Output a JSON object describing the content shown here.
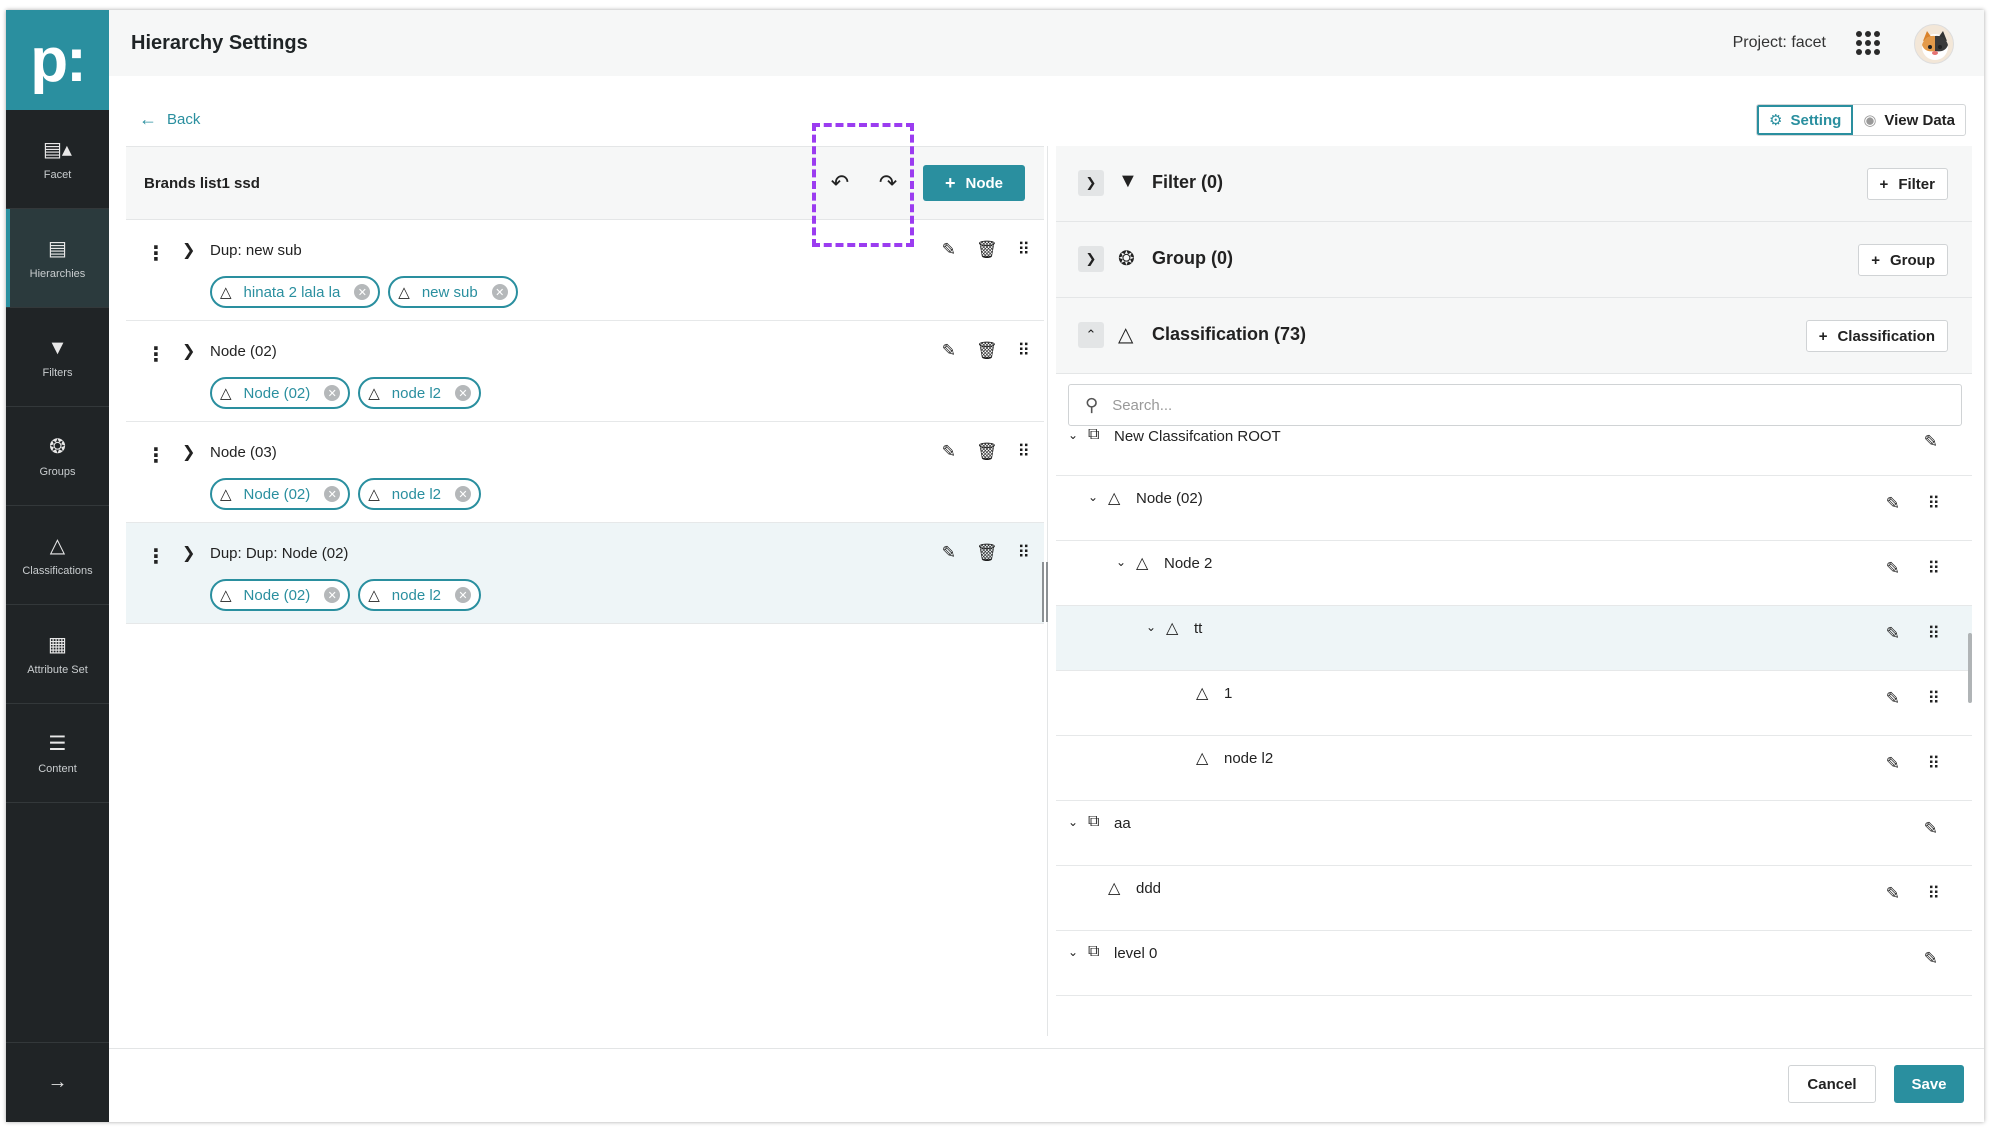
{
  "header": {
    "title": "Hierarchy Settings",
    "project": "Project: facet"
  },
  "sidebar": {
    "logo": "p:",
    "items": [
      {
        "label": "Facet",
        "icon": "facet-icon"
      },
      {
        "label": "Hierarchies",
        "icon": "hierarchies-icon"
      },
      {
        "label": "Filters",
        "icon": "filter-icon"
      },
      {
        "label": "Groups",
        "icon": "groups-icon"
      },
      {
        "label": "Classifications",
        "icon": "classifications-icon"
      },
      {
        "label": "Attribute Set",
        "icon": "attribute-set-icon"
      },
      {
        "label": "Content",
        "icon": "content-icon"
      }
    ]
  },
  "nav": {
    "back": "Back",
    "setting": "Setting",
    "view_data": "View Data"
  },
  "left": {
    "title": "Brands list1 ssd",
    "add_node": "Node",
    "rows": [
      {
        "name": "Dup: new sub",
        "chips": [
          "hinata 2 lala la",
          "new sub"
        ]
      },
      {
        "name": "Node (02)",
        "chips": [
          "Node (02)",
          "node l2"
        ]
      },
      {
        "name": "Node (03)",
        "chips": [
          "Node (02)",
          "node l2"
        ]
      },
      {
        "name": "Dup: Dup: Node (02)",
        "chips": [
          "Node (02)",
          "node l2"
        ]
      }
    ]
  },
  "right": {
    "filter": {
      "title": "Filter (0)",
      "button": "Filter"
    },
    "group": {
      "title": "Group (0)",
      "button": "Group"
    },
    "classification": {
      "title": "Classification (73)",
      "button": "Classification"
    },
    "search_placeholder": "Search...",
    "tree": [
      {
        "label": "New Classifcation ROOT"
      },
      {
        "label": "Node (02)"
      },
      {
        "label": "Node 2"
      },
      {
        "label": "tt"
      },
      {
        "label": "1"
      },
      {
        "label": "node l2"
      },
      {
        "label": "aa"
      },
      {
        "label": "ddd"
      },
      {
        "label": "level 0"
      }
    ]
  },
  "footer": {
    "cancel": "Cancel",
    "save": "Save"
  },
  "colors": {
    "accent": "#2a8f9f",
    "sidebar": "#202426",
    "highlight": "#9b3cf0"
  }
}
